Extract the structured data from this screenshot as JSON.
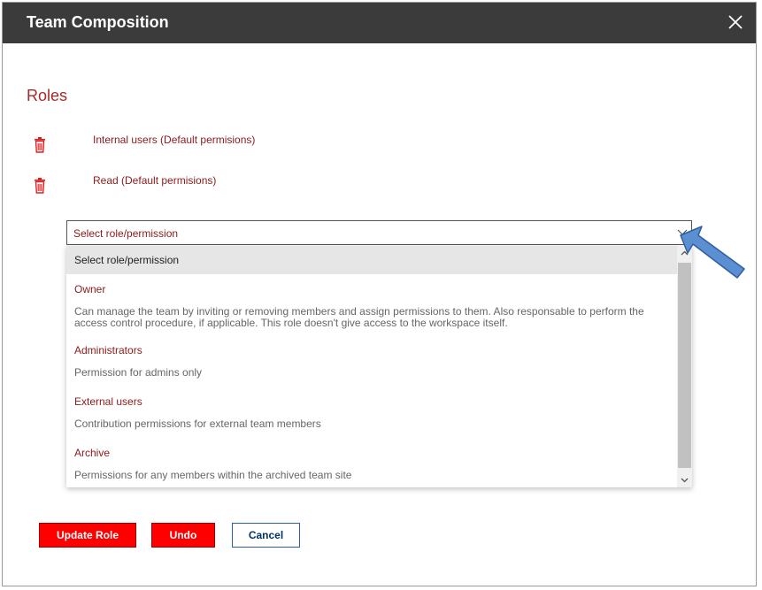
{
  "dialog": {
    "title": "Team Composition"
  },
  "roles_section": {
    "title": "Roles",
    "items": [
      {
        "label": "Internal users (Default permisions)"
      },
      {
        "label": "Read (Default permisions)"
      }
    ]
  },
  "select": {
    "value": "Select role/permission",
    "options": [
      {
        "name": "Owner",
        "desc": "Can manage the team by inviting or removing members and assign permissions to them. Also responsable to perform the access control procedure, if applicable. This role doesn't give access to the workspace itself."
      },
      {
        "name": "Administrators",
        "desc": "Permission for admins only"
      },
      {
        "name": "External users",
        "desc": "Contribution permissions for external team members"
      },
      {
        "name": "Archive",
        "desc": "Permissions for any members within the archived team site"
      }
    ],
    "placeholder_option": "Select role/permission"
  },
  "buttons": {
    "update": "Update Role",
    "undo": "Undo",
    "cancel": "Cancel"
  },
  "colors": {
    "header_bg": "#3b3b3b",
    "accent_red": "#ff0000",
    "role_text": "#8b1a1a",
    "arrow_blue": "#5b8fd1"
  }
}
